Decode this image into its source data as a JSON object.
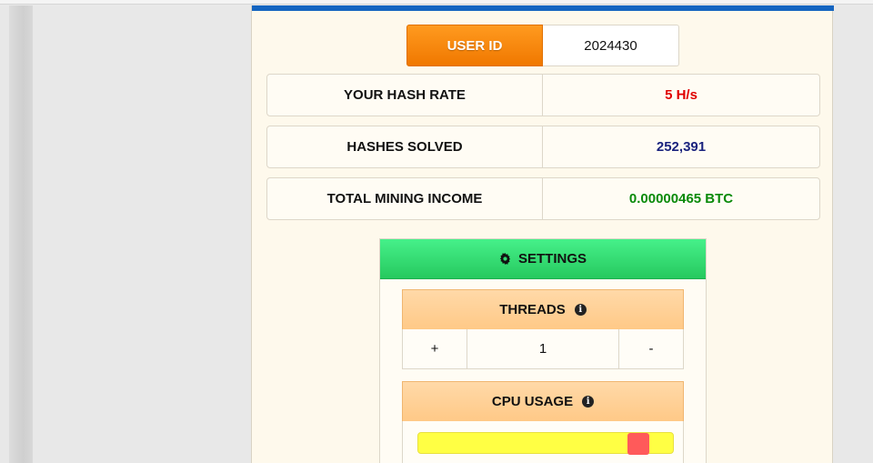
{
  "user": {
    "label": "USER ID",
    "value": "2024430"
  },
  "stats": [
    {
      "label": "YOUR HASH RATE",
      "value": "5 H/s",
      "color": "#e00000"
    },
    {
      "label": "HASHES SOLVED",
      "value": "252,391",
      "color": "#1a237e"
    },
    {
      "label": "TOTAL MINING INCOME",
      "value": "0.00000465 BTC",
      "color": "#0a8a0a"
    }
  ],
  "settings": {
    "title": "SETTINGS",
    "icon": "gear-icon",
    "threads": {
      "label": "THREADS",
      "icon": "info-icon",
      "plus": "+",
      "value": "1",
      "minus": "-"
    },
    "cpu": {
      "label": "CPU USAGE",
      "icon": "info-icon",
      "level_fraction": 0.9
    }
  },
  "colors": {
    "accent_bar": "#1565c0",
    "userid_orange": "#f07800",
    "settings_green": "#26c95e",
    "slider_track": "#ffff44",
    "slider_handle": "#ff5a5a"
  }
}
